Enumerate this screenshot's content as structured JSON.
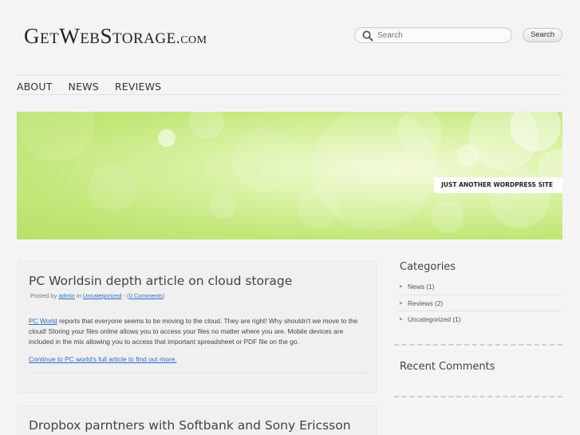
{
  "site": {
    "logo_main": "GetWebStorage",
    "logo_suffix": ".com"
  },
  "search": {
    "placeholder": "Search",
    "button_label": "Search",
    "icon": "search-icon"
  },
  "nav": {
    "items": [
      {
        "label": "About"
      },
      {
        "label": "News"
      },
      {
        "label": "Reviews"
      }
    ]
  },
  "banner": {
    "tagline": "Just another WordPress site",
    "color": "#c2e779"
  },
  "posts": [
    {
      "title": "PC Worldsin depth article on cloud storage",
      "meta_prefix": "Posted by",
      "author": "admin",
      "meta_in": "in",
      "category": "Uncategorized",
      "meta_sep": "-",
      "comments_open": "(",
      "comments": "0 Comments",
      "comments_close": ")",
      "body_link": "PC World",
      "body_text": " reports that everyone seems to be moving to the cloud.  They are right! Why shouldn't we move to the cloud! Storing your files online allows you to access your files no matter where you are.  Mobile devices are included in the mix allowing you to access that important spreadsheet or PDF file on the go.",
      "more_link": "Continue to PC world's full article to find out more."
    },
    {
      "title": "Dropbox parntners with Softbank and Sony Ericsson"
    }
  ],
  "sidebar": {
    "categories_title": "Categories",
    "categories": [
      {
        "name": "News",
        "count": "(1)"
      },
      {
        "name": "Reviews",
        "count": "(2)"
      },
      {
        "name": "Uncategorized",
        "count": "(1)"
      }
    ],
    "recent_comments_title": "Recent Comments"
  },
  "colors": {
    "link": "#2d6ec4",
    "banner_green": "#c2e779",
    "page_bg": "#f4f4f4"
  }
}
